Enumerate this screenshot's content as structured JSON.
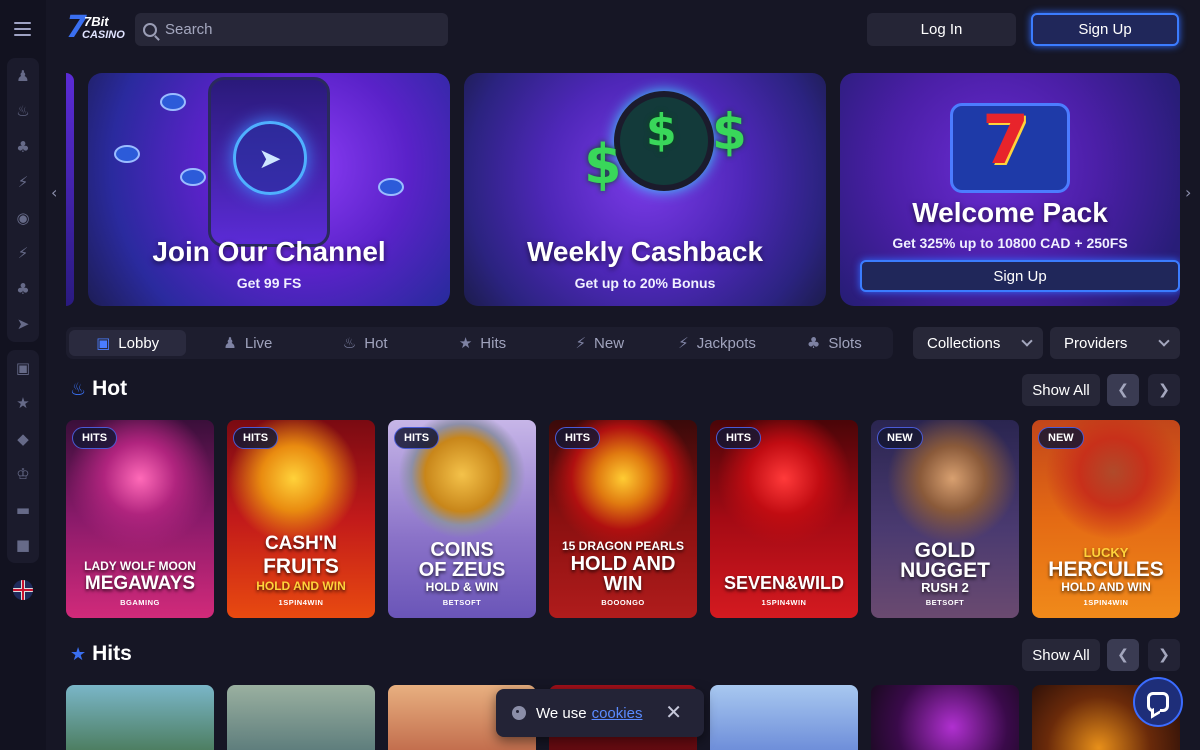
{
  "header": {
    "logo_main": "7Bit",
    "logo_sub": "CASINO",
    "search_placeholder": "Search",
    "login_label": "Log In",
    "signup_label": "Sign Up"
  },
  "sidebar": {
    "icons": [
      "live-dealer-icon",
      "fire-icon",
      "spade-icon",
      "hits-icon",
      "target-icon",
      "new-icon",
      "cards-icon",
      "rocket-icon",
      "gift-icon",
      "trophy-icon",
      "vip-icon",
      "crown-icon",
      "card-icon",
      "shop-icon"
    ],
    "language_flag": "uk-flag-icon"
  },
  "banners": [
    {
      "title": "Join Our Channel",
      "subtitle": "Get 99 FS"
    },
    {
      "title": "Weekly Cashback",
      "subtitle": "Get up to 20% Bonus"
    },
    {
      "title": "Welcome Pack",
      "subtitle": "Get 325% up to 10800 CAD + 250FS",
      "button": "Sign Up"
    }
  ],
  "tabs": [
    {
      "label": "Lobby",
      "icon": "lobby-icon",
      "active": true
    },
    {
      "label": "Live",
      "icon": "live-icon"
    },
    {
      "label": "Hot",
      "icon": "fire-icon"
    },
    {
      "label": "Hits",
      "icon": "hits-icon"
    },
    {
      "label": "New",
      "icon": "new-icon"
    },
    {
      "label": "Jackpots",
      "icon": "jackpot-icon"
    },
    {
      "label": "Slots",
      "icon": "slots-icon"
    }
  ],
  "filters": {
    "collections": "Collections",
    "providers": "Providers"
  },
  "sections": {
    "hot": {
      "title": "Hot",
      "show_all": "Show All",
      "games": [
        {
          "badge": "HITS",
          "name1": "LADY WOLF MOON",
          "name2": "MEGAWAYS",
          "provider": "BGAMING"
        },
        {
          "badge": "HITS",
          "name1": "CASH'N",
          "name2": "FRUITS",
          "name3": "HOLD AND WIN",
          "provider": "1SPIN4WIN"
        },
        {
          "badge": "HITS",
          "name1": "COINS",
          "name2": "OF ZEUS",
          "name3": "HOLD & WIN",
          "provider": "BETSOFT"
        },
        {
          "badge": "HITS",
          "name1": "15 DRAGON PEARLS",
          "name2": "HOLD AND",
          "name3": "WIN",
          "provider": "BOOONGO"
        },
        {
          "badge": "HITS",
          "name1": "SEVEN&WILD",
          "provider": "1SPIN4WIN"
        },
        {
          "badge": "NEW",
          "name1": "GOLD",
          "name2": "NUGGET",
          "name3": "RUSH 2",
          "provider": "BETSOFT"
        },
        {
          "badge": "NEW",
          "name1": "LUCKY",
          "name2": "HERCULES",
          "name3": "HOLD AND WIN",
          "provider": "1SPIN4WIN"
        }
      ]
    },
    "hits": {
      "title": "Hits",
      "show_all": "Show All"
    }
  },
  "cookie": {
    "text": "We use",
    "link": "cookies"
  },
  "colors": {
    "accent": "#3b7cff",
    "background": "#161625"
  }
}
